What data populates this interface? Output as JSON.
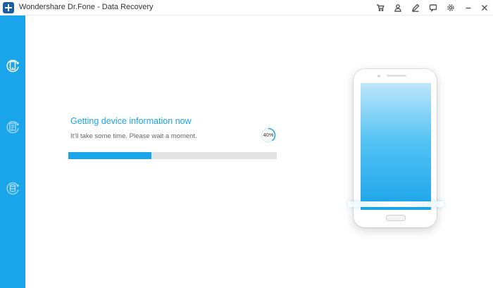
{
  "window": {
    "title": "Wondershare Dr.Fone - Data Recovery",
    "logo_icon": "plus-logo-icon"
  },
  "titlebar": {
    "buttons": [
      {
        "name": "cart-icon"
      },
      {
        "name": "user-icon"
      },
      {
        "name": "edit-icon"
      },
      {
        "name": "feedback-icon"
      },
      {
        "name": "settings-icon"
      },
      {
        "name": "minimize-icon"
      },
      {
        "name": "close-icon"
      }
    ]
  },
  "sidebar": {
    "items": [
      {
        "name": "recover-from-device",
        "icon": "phone-recover-icon",
        "active": true
      },
      {
        "name": "recover-from-itunes",
        "icon": "itunes-backup-icon",
        "active": false
      },
      {
        "name": "recover-from-icloud",
        "icon": "icloud-backup-icon",
        "active": false
      }
    ],
    "color": "#1aa4ea"
  },
  "main": {
    "heading": "Getting device information now",
    "subtext": "It'll take some time. Please wait a moment.",
    "progress": {
      "percent_label": "40%",
      "fraction": 0.4
    }
  },
  "colors": {
    "accent": "#1aa4ea",
    "track": "#e3e3e3"
  }
}
